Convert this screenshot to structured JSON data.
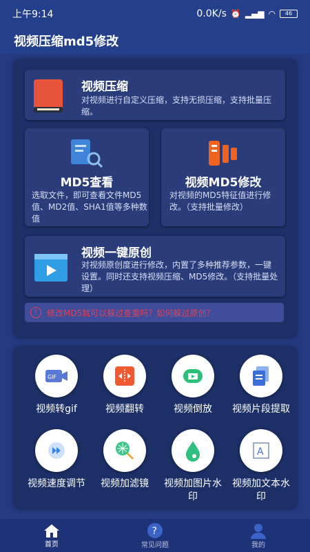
{
  "status": {
    "time": "上午9:14",
    "net": "0.0K/s",
    "battery": "46"
  },
  "app": {
    "title": "视频压缩md5修改"
  },
  "features": {
    "compress": {
      "title": "视频压缩",
      "desc": "对视频进行自定义压缩，支持无损压缩，支持批量压缩。"
    },
    "md5view": {
      "title": "MD5查看",
      "desc": "选取文件，即可查看文件MD5值、MD2值、SHA1值等多种数值"
    },
    "md5edit": {
      "title": "视频MD5修改",
      "desc": "对视频的MD5特征值进行修改。（支持批量修改）"
    },
    "original": {
      "title": "视频一键原创",
      "desc": "对视频原创度进行修改，内置了多种推荐参数，一键设置。同时还支持视频压缩、MD5修改。（支持批量处理）"
    }
  },
  "warning": {
    "text": "修改MD5就可以躲过查重吗？如何躲过原创？"
  },
  "tools": [
    {
      "label": "视频转gif",
      "icon": "gif-camera-icon"
    },
    {
      "label": "视频翻转",
      "icon": "flip-icon"
    },
    {
      "label": "视频倒放",
      "icon": "rewind-icon"
    },
    {
      "label": "视频片段提取",
      "icon": "clip-extract-icon"
    },
    {
      "label": "视频速度调节",
      "icon": "speed-icon"
    },
    {
      "label": "视频加滤镜",
      "icon": "filter-icon"
    },
    {
      "label": "视频加图片水印",
      "icon": "image-watermark-icon"
    },
    {
      "label": "视频加文本水印",
      "icon": "text-watermark-icon"
    }
  ],
  "tabs": [
    {
      "label": "首页",
      "active": true
    },
    {
      "label": "常见问题",
      "active": false
    },
    {
      "label": "我的",
      "active": false
    }
  ],
  "colors": {
    "background": "#233a80",
    "panel": "#2a3d7a",
    "warning": "#e2435b"
  }
}
